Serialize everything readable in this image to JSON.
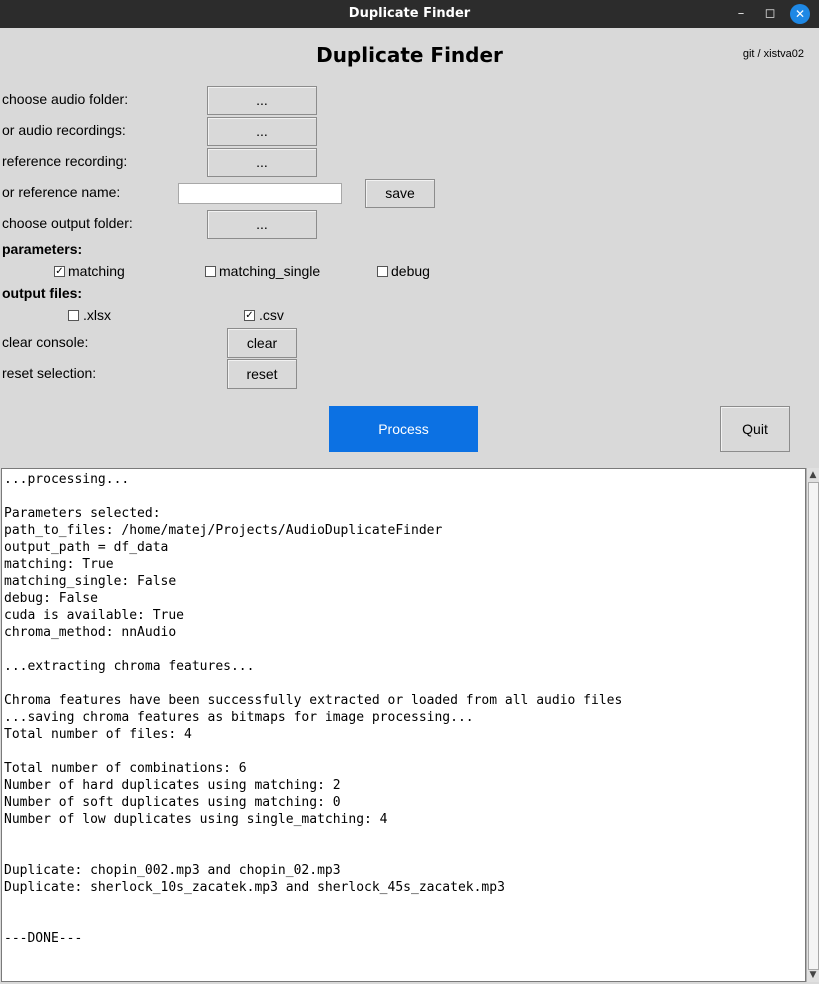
{
  "window": {
    "title": "Duplicate Finder"
  },
  "header": {
    "title": "Duplicate Finder",
    "git": "git / xistva02"
  },
  "form": {
    "audio_folder_label": "choose audio folder:",
    "audio_recordings_label": "or audio recordings:",
    "reference_recording_label": "reference recording:",
    "reference_name_label": "or reference name:",
    "reference_name_value": "",
    "output_folder_label": "choose output folder:",
    "browse_label": "...",
    "save_label": "save"
  },
  "parameters": {
    "title": "parameters:",
    "items": [
      {
        "label": "matching",
        "checked": true
      },
      {
        "label": "matching_single",
        "checked": false
      },
      {
        "label": "debug",
        "checked": false
      }
    ]
  },
  "output_files": {
    "title": "output files:",
    "items": [
      {
        "label": ".xlsx",
        "checked": false
      },
      {
        "label": ".csv",
        "checked": true
      }
    ]
  },
  "actions": {
    "clear_console_label": "clear console:",
    "clear_button": "clear",
    "reset_selection_label": "reset selection:",
    "reset_button": "reset",
    "process_button": "Process",
    "quit_button": "Quit"
  },
  "console": {
    "lines": [
      "...processing...",
      "",
      "Parameters selected:",
      "path_to_files: /home/matej/Projects/AudioDuplicateFinder",
      "output_path = df_data",
      "matching: True",
      "matching_single: False",
      "debug: False",
      "cuda is available: True",
      "chroma_method: nnAudio",
      "",
      "...extracting chroma features...",
      "",
      "Chroma features have been successfully extracted or loaded from all audio files",
      "...saving chroma features as bitmaps for image processing...",
      "Total number of files: 4",
      "",
      "Total number of combinations: 6",
      "Number of hard duplicates using matching: 2",
      "Number of soft duplicates using matching: 0",
      "Number of low duplicates using single_matching: 4",
      "",
      "",
      "Duplicate: chopin_002.mp3 and chopin_02.mp3",
      "Duplicate: sherlock_10s_zacatek.mp3 and sherlock_45s_zacatek.mp3",
      "",
      "",
      "---DONE---"
    ]
  }
}
